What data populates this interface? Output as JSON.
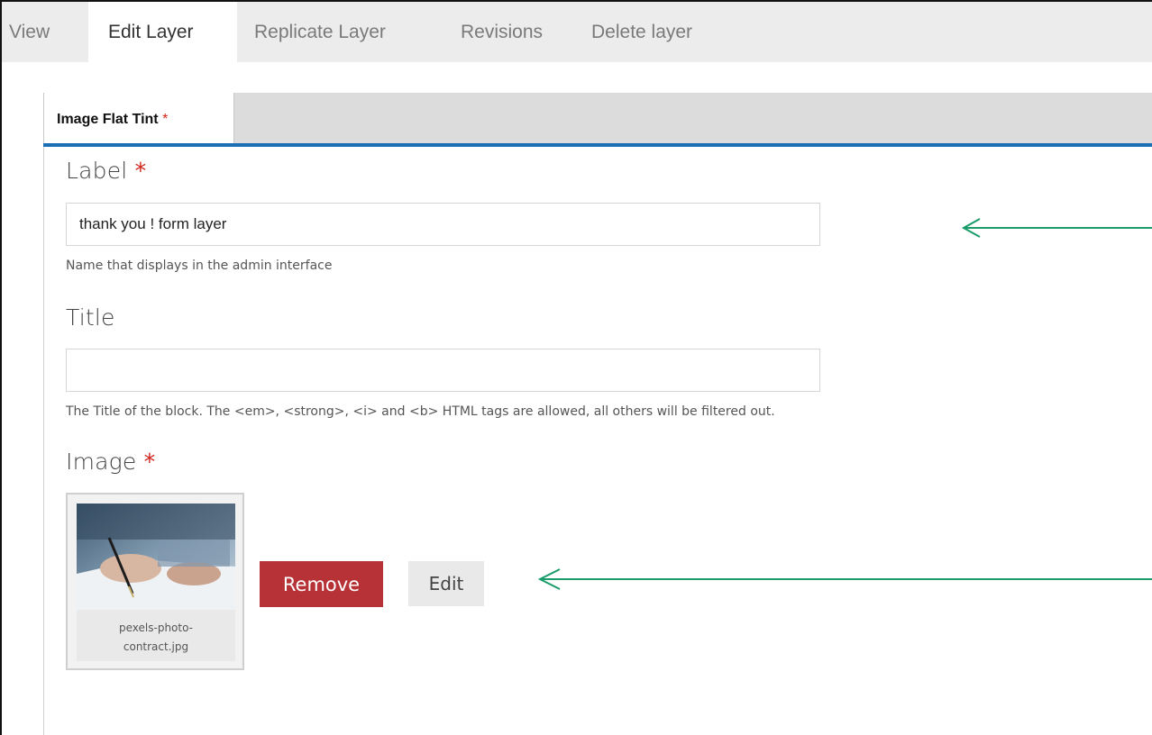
{
  "tabs": [
    {
      "label": "View",
      "active": false
    },
    {
      "label": "Edit Layer",
      "active": true
    },
    {
      "label": "Replicate Layer",
      "active": false
    },
    {
      "label": "Revisions",
      "active": false
    },
    {
      "label": "Delete layer",
      "active": false
    }
  ],
  "vertical_tab": {
    "label": "Image Flat Tint",
    "required_mark": "*"
  },
  "fields": {
    "label": {
      "title": "Label",
      "required_mark": "*",
      "value": "thank you ! form layer",
      "help": "Name that displays in the admin interface"
    },
    "title": {
      "title": "Title",
      "value": "",
      "help": "The Title of the block. The <em>, <strong>, <i> and <b> HTML tags are allowed, all others will be filtered out."
    },
    "image": {
      "title": "Image",
      "required_mark": "*",
      "filename_line1": "pexels-photo-",
      "filename_line2": "contract.jpg",
      "remove_label": "Remove",
      "edit_label": "Edit"
    }
  },
  "colors": {
    "accent_blue": "#1a6fb4",
    "remove_red": "#b73236",
    "required_red": "#d0241c",
    "annotation_arrow": "#1a9b6a"
  },
  "icons": {
    "thumbnail": "signing-contract-photo",
    "annotation": "left-arrow-icon"
  }
}
